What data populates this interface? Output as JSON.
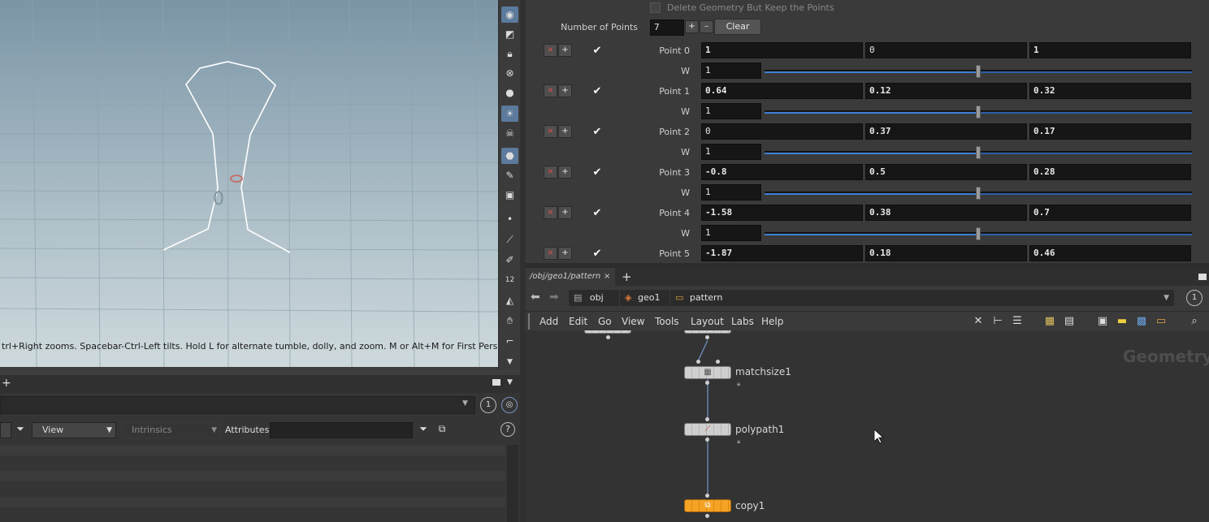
{
  "viewport": {
    "hint": "trl+Right zooms. Spacebar-Ctrl-Left tilts. Hold L for alternate tumble, dolly, and zoom. M or Alt+M for First Person",
    "toolbar_icons": [
      "eye-icon",
      "select-geometry-icon",
      "lock-icon",
      "cross-ghost-icon",
      "sphere-icon",
      "light-bulb-icon",
      "skull-icon",
      "camera-icon",
      "eyedropper-icon",
      "palette-icon",
      "dot-icon",
      "brush-icon",
      "pen-icon",
      "number-icon",
      "bucket-icon",
      "hand-icon",
      "curve-icon",
      "chevron-down-icon"
    ],
    "number_badge": "12"
  },
  "spreadsheet": {
    "path_number": "1",
    "view_select": "View",
    "intrinsics_select": "Intrinsics",
    "attributes_label": "Attributes:",
    "help": "?"
  },
  "params": {
    "delete_geo_label": "Delete Geometry But Keep the Points",
    "num_points_label": "Number of Points",
    "num_points_value": "7",
    "plus": "+",
    "minus": "–",
    "clear_label": "Clear",
    "remove": "×",
    "add": "+",
    "check": "✔",
    "w_label": "W",
    "points": [
      {
        "label": "Point 0",
        "x": "1",
        "y": "0",
        "z": "1",
        "w": "1",
        "bold": [
          true,
          false,
          true
        ]
      },
      {
        "label": "Point 1",
        "x": "0.64",
        "y": "0.12",
        "z": "0.32",
        "w": "1",
        "bold": [
          true,
          true,
          true
        ]
      },
      {
        "label": "Point 2",
        "x": "0",
        "y": "0.37",
        "z": "0.17",
        "w": "1",
        "bold": [
          false,
          true,
          true
        ]
      },
      {
        "label": "Point 3",
        "x": "-0.8",
        "y": "0.5",
        "z": "0.28",
        "w": "1",
        "bold": [
          true,
          true,
          true
        ]
      },
      {
        "label": "Point 4",
        "x": "-1.58",
        "y": "0.38",
        "z": "0.7",
        "w": "1",
        "bold": [
          true,
          true,
          true
        ]
      },
      {
        "label": "Point 5",
        "x": "-1.87",
        "y": "0.18",
        "z": "0.46",
        "w": "",
        "bold": [
          true,
          true,
          true
        ]
      }
    ],
    "w_slider_fraction": 0.5
  },
  "network": {
    "tab_label": "/obj/geo1/pattern",
    "tab_close": "×",
    "tab_add": "+",
    "path_number": "1",
    "crumbs": [
      "obj",
      "geo1",
      "pattern"
    ],
    "menu": [
      "Add",
      "Edit",
      "Go",
      "View",
      "Tools",
      "Layout",
      "Labs",
      "Help"
    ],
    "watermark": "Geometry",
    "nodes": [
      {
        "name": "matchsize1",
        "color": "gray"
      },
      {
        "name": "polypath1",
        "color": "gray"
      },
      {
        "name": "copy1",
        "color": "orange"
      }
    ]
  }
}
